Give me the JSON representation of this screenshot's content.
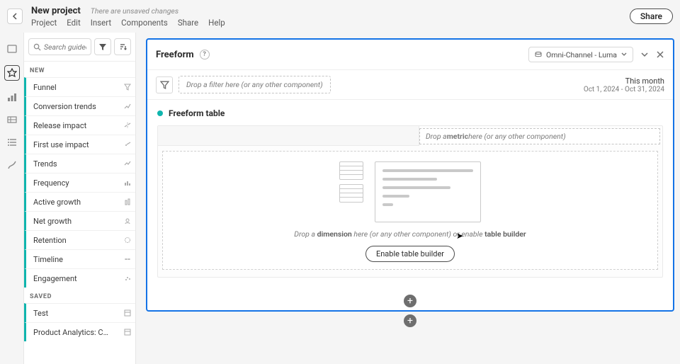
{
  "header": {
    "project_title": "New project",
    "unsaved_msg": "There are unsaved changes",
    "share_label": "Share",
    "menu": [
      "Project",
      "Edit",
      "Insert",
      "Components",
      "Share",
      "Help"
    ]
  },
  "panel": {
    "search_placeholder": "Search guided ana…",
    "sections": {
      "new_label": "NEW",
      "saved_label": "SAVED"
    },
    "new_items": [
      {
        "label": "Funnel"
      },
      {
        "label": "Conversion trends"
      },
      {
        "label": "Release impact"
      },
      {
        "label": "First use impact"
      },
      {
        "label": "Trends"
      },
      {
        "label": "Frequency"
      },
      {
        "label": "Active growth"
      },
      {
        "label": "Net growth"
      },
      {
        "label": "Retention"
      },
      {
        "label": "Timeline"
      },
      {
        "label": "Engagement"
      }
    ],
    "saved_items": [
      {
        "label": "Test"
      },
      {
        "label": "Product Analytics: Campai…"
      }
    ]
  },
  "freeform": {
    "title": "Freeform",
    "data_view": "Omni-Channel - Luma",
    "filter_drop_hint": "Drop a filter here (or any other component)",
    "date_label": "This month",
    "date_range": "Oct 1, 2024 - Oct 31, 2024",
    "table_title": "Freeform table",
    "metric_hint_pre": "Drop a ",
    "metric_hint_bold": "metric",
    "metric_hint_post": " here (or any other component)",
    "dim_hint_pre": "Drop a ",
    "dim_hint_b1": "dimension",
    "dim_hint_mid": " here (or any other component) or enable ",
    "dim_hint_b2": "table builder",
    "enable_label": "Enable table builder"
  }
}
